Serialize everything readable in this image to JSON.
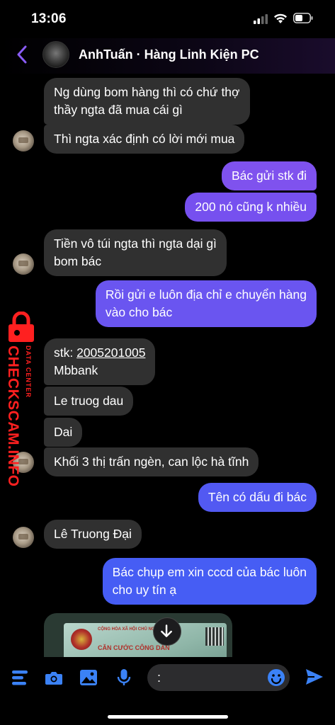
{
  "status": {
    "time": "13:06"
  },
  "header": {
    "title": "AnhTuấn · Hàng Linh Kiện PC"
  },
  "messages": [
    {
      "dir": "in",
      "lines": [
        "Ng dùng bom hàng thì có chứ thợ",
        "thầy ngta đã mua cái gì"
      ]
    },
    {
      "dir": "in",
      "lines": [
        "Thì ngta xác định có lời mới mua"
      ]
    },
    {
      "dir": "out",
      "lines": [
        "Bác gửi stk đi"
      ]
    },
    {
      "dir": "out",
      "lines": [
        "200 nó cũng k nhiều"
      ]
    },
    {
      "dir": "in",
      "lines": [
        "Tiền vô túi ngta thì ngta dại gì",
        "bom bác"
      ]
    },
    {
      "dir": "out",
      "lines": [
        "Rồi gửi e luôn địa chỉ e chuyển hàng",
        "vào cho bác"
      ]
    },
    {
      "dir": "in",
      "lines": [
        "stk: ",
        "2005201005",
        "Mbbank"
      ]
    },
    {
      "dir": "in",
      "lines": [
        "Le truog dau"
      ]
    },
    {
      "dir": "in",
      "lines": [
        "Dai"
      ]
    },
    {
      "dir": "in",
      "lines": [
        "Khối 3 thị trấn ngèn, can lộc hà tĩnh"
      ]
    },
    {
      "dir": "out",
      "lines": [
        "Tên có dấu đi bác"
      ]
    },
    {
      "dir": "in",
      "lines": [
        "Lê Truong Đại"
      ]
    },
    {
      "dir": "out",
      "lines": [
        "Bác chụp em xin cccd của bác luôn",
        "cho uy tín ạ"
      ]
    }
  ],
  "photo": {
    "line1": "CỘNG HÒA XÃ HỘI CHỦ NGHĨA",
    "line2": "CĂN CƯỚC CÔNG DÂN"
  },
  "watermark": {
    "brand": "CHECKSCAM.INFO",
    "sub": "DATA CENTER"
  },
  "composer": {
    "input_value": ":"
  },
  "colors": {
    "outgoing_top": "#8a4df0",
    "outgoing_bottom": "#4a5cf5",
    "incoming": "#303030",
    "accent": "#3b82f6",
    "watermark": "#ff2020"
  }
}
